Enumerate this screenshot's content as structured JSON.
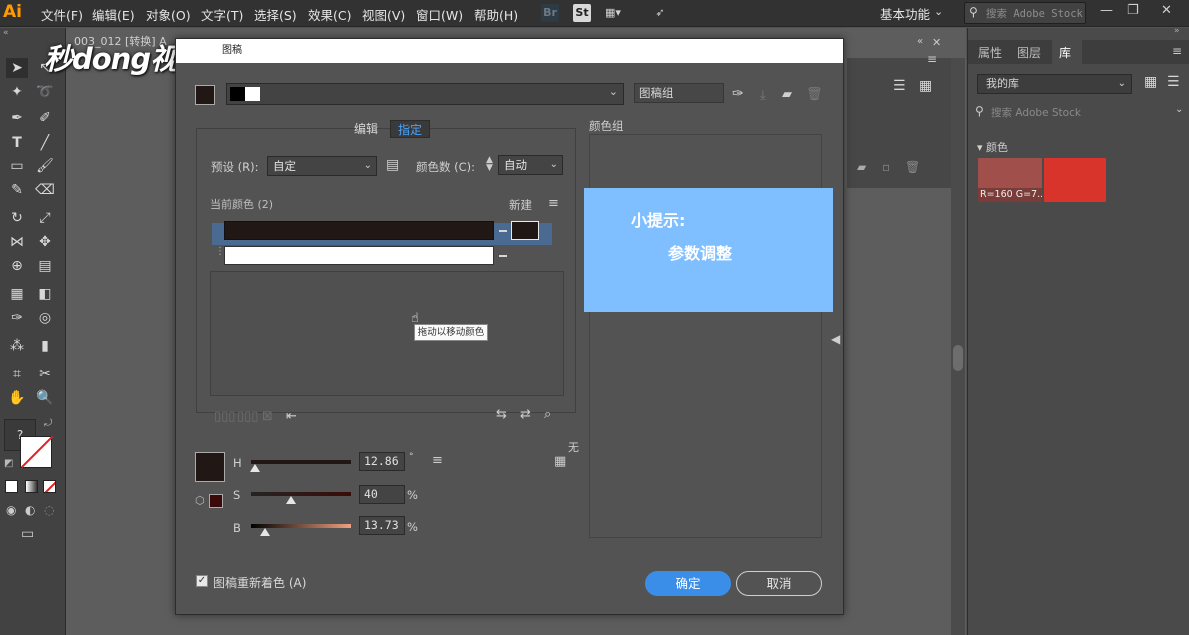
{
  "app": {
    "logo": "Ai",
    "workspace": "基本功能",
    "stock_search_placeholder": "搜索 Adobe Stock"
  },
  "menu": [
    "文件(F)",
    "编辑(E)",
    "对象(O)",
    "文字(T)",
    "选择(S)",
    "效果(C)",
    "视图(V)",
    "窗口(W)",
    "帮助(H)"
  ],
  "app_icons": [
    "Br",
    "St"
  ],
  "document": {
    "tab_label": "003_012 [转换] A"
  },
  "watermark": "秒dong视频",
  "right_panel": {
    "tabs": [
      "属性",
      "图层",
      "库"
    ],
    "library_select": "我的库",
    "search_placeholder": "搜索 Adobe Stock",
    "colors_section": "颜色",
    "swatches": [
      {
        "label": "R=160 G=7...",
        "color": "#a04f4a"
      },
      {
        "label": "",
        "color": "#d9342c"
      }
    ]
  },
  "dialog": {
    "title": "图稿",
    "art_group": "图稿组",
    "tabs": {
      "edit": "编辑",
      "assign": "指定"
    },
    "preset_label": "预设 (R):",
    "preset_value": "自定",
    "color_count_label": "颜色数 (C):",
    "color_count_value": "自动",
    "current_colors_label": "当前颜色 (2)",
    "new_label": "新建",
    "tooltip": "拖动以移动颜色",
    "color_groups_label": "颜色组",
    "tip_title": "小提示:",
    "tip_body": "参数调整",
    "none_label": "无",
    "hsb": {
      "h": {
        "label": "H",
        "value": "12.86",
        "unit": "°"
      },
      "s": {
        "label": "S",
        "value": "40",
        "unit": "%"
      },
      "b": {
        "label": "B",
        "value": "13.73",
        "unit": "%"
      }
    },
    "recolor_label": "图稿重新着色 (A)",
    "recolor_checked": true,
    "ok": "确定",
    "cancel": "取消",
    "current_color": "#211815"
  }
}
